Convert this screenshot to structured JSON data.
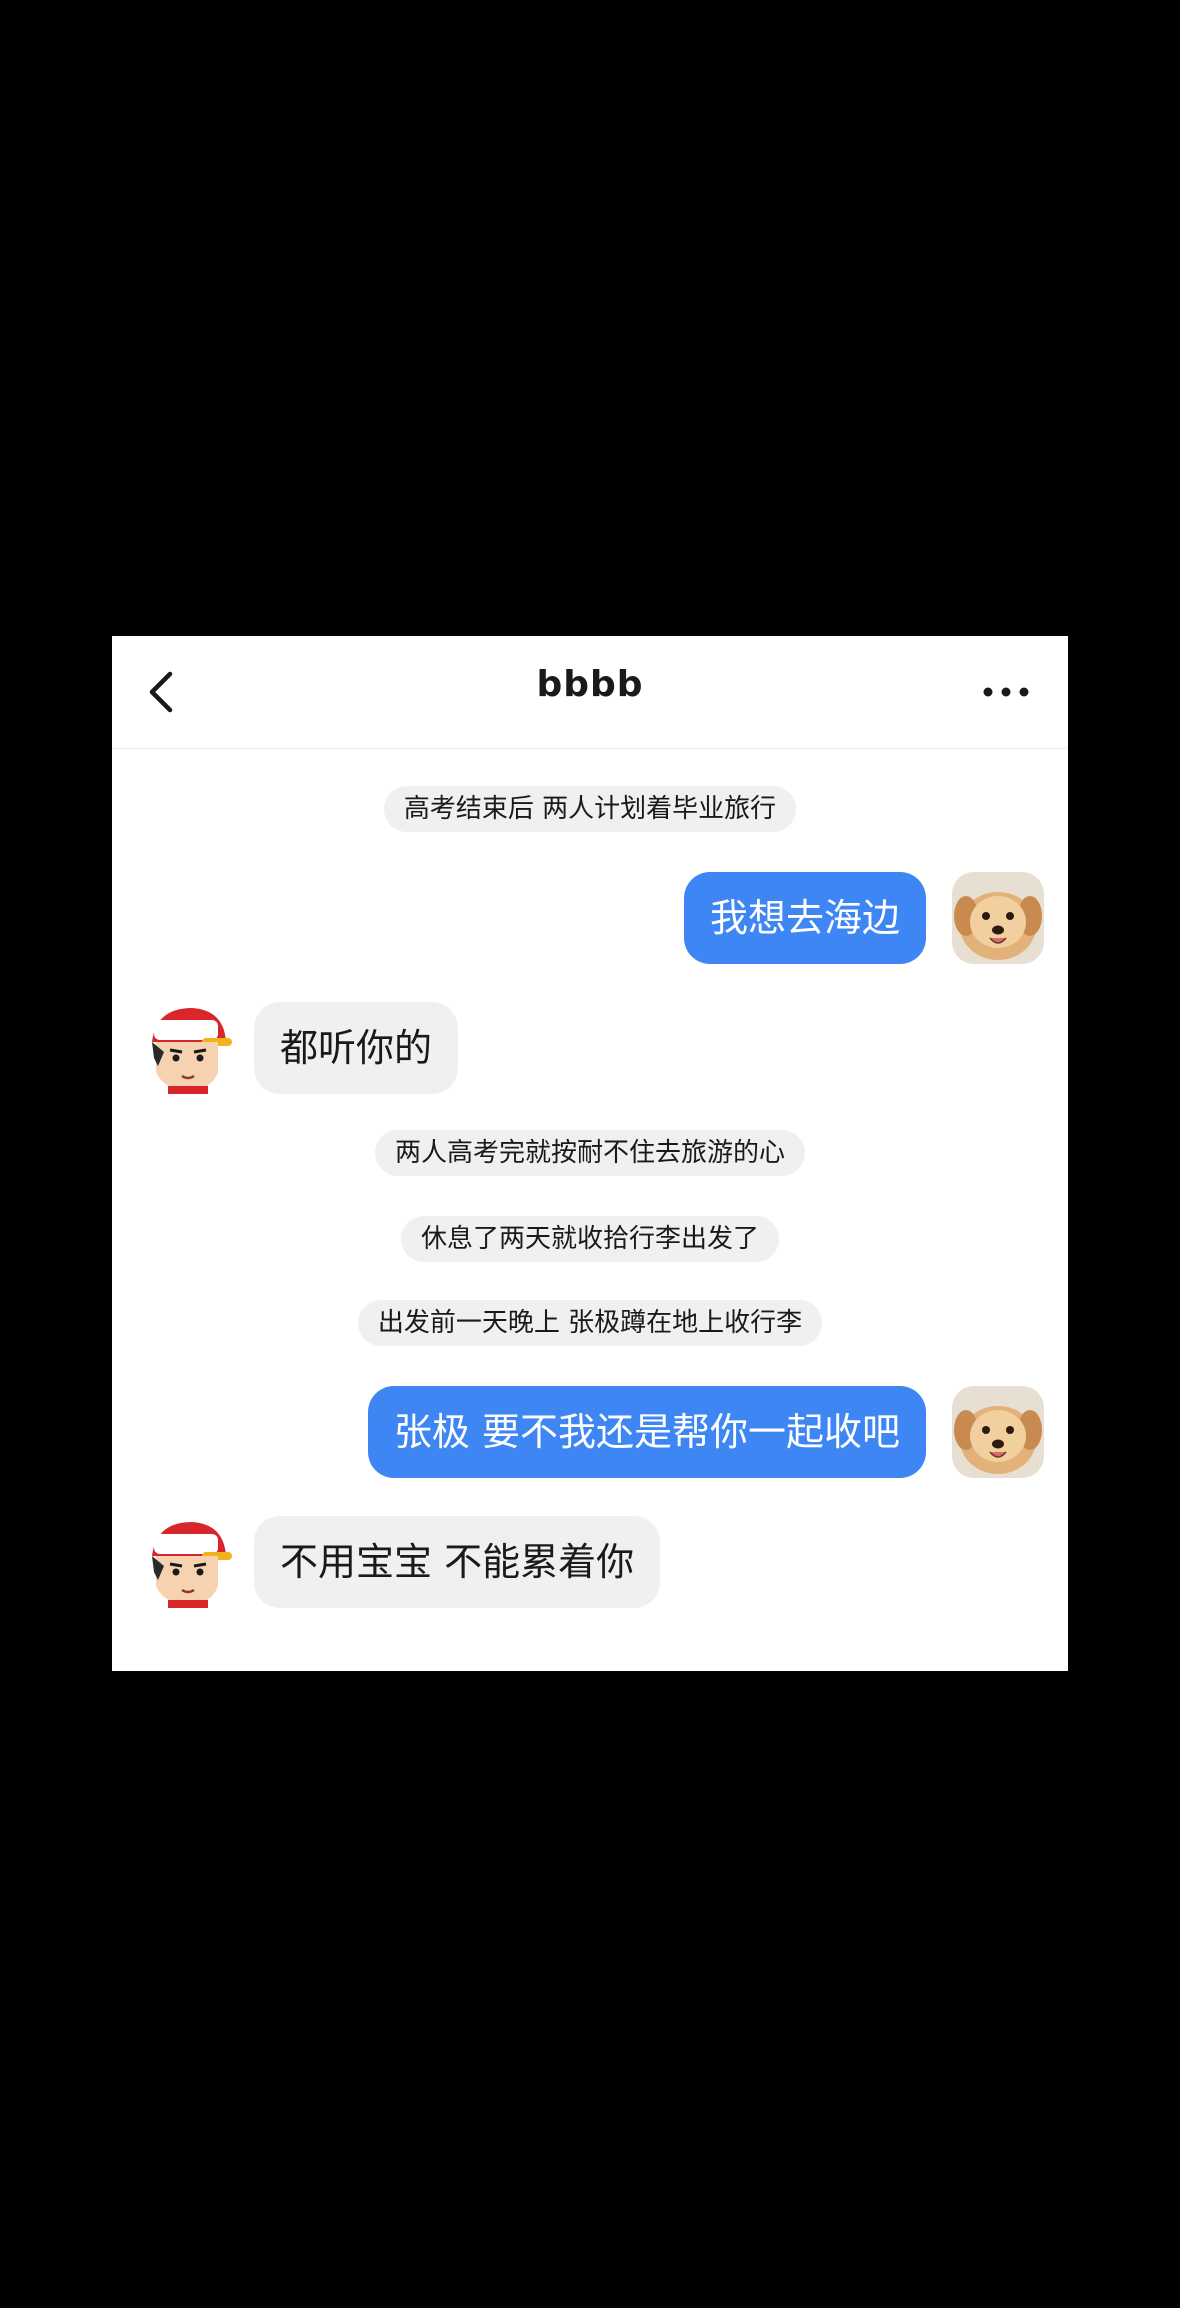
{
  "header": {
    "title": "bbbb",
    "back_icon": "chevron-left-icon",
    "more_icon": "more-horizontal-icon"
  },
  "messages": [
    {
      "type": "system",
      "text": "高考结束后 两人计划着毕业旅行"
    },
    {
      "type": "me",
      "text": "我想去海边",
      "avatar": "dog-avatar"
    },
    {
      "type": "them",
      "text": "都听你的",
      "avatar": "cartoon-boy-avatar"
    },
    {
      "type": "system",
      "text": "两人高考完就按耐不住去旅游的心"
    },
    {
      "type": "system",
      "text": "休息了两天就收拾行李出发了"
    },
    {
      "type": "system",
      "text": "出发前一天晚上 张极蹲在地上收行李"
    },
    {
      "type": "me",
      "text": "张极 要不我还是帮你一起收吧",
      "avatar": "dog-avatar"
    },
    {
      "type": "them",
      "text": "不用宝宝 不能累着你",
      "avatar": "cartoon-boy-avatar"
    }
  ],
  "colors": {
    "outgoing_bubble": "#3d86f3",
    "incoming_bubble": "#f0f0f0",
    "background": "#000000"
  }
}
